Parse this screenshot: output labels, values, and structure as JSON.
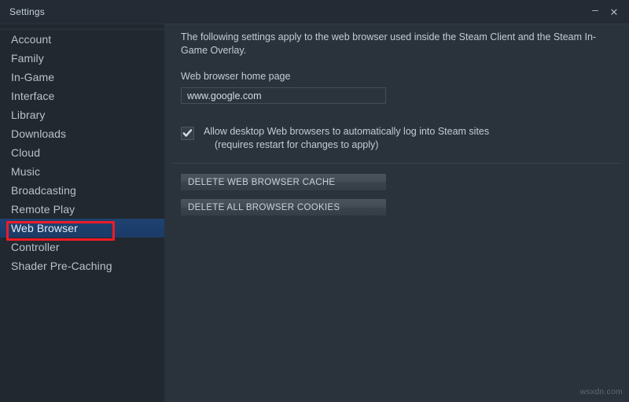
{
  "window": {
    "title": "Settings",
    "minimize_label": "–",
    "close_label": "✕"
  },
  "sidebar": {
    "items": [
      {
        "label": "Account",
        "selected": false
      },
      {
        "label": "Family",
        "selected": false
      },
      {
        "label": "In-Game",
        "selected": false
      },
      {
        "label": "Interface",
        "selected": false
      },
      {
        "label": "Library",
        "selected": false
      },
      {
        "label": "Downloads",
        "selected": false
      },
      {
        "label": "Cloud",
        "selected": false
      },
      {
        "label": "Music",
        "selected": false
      },
      {
        "label": "Broadcasting",
        "selected": false
      },
      {
        "label": "Remote Play",
        "selected": false
      },
      {
        "label": "Web Browser",
        "selected": true
      },
      {
        "label": "Controller",
        "selected": false
      },
      {
        "label": "Shader Pre-Caching",
        "selected": false
      }
    ],
    "selected_item": "Web Browser"
  },
  "annotation": {
    "target": "Web Browser",
    "color": "#ee1c25"
  },
  "content": {
    "intro": "The following settings apply to the web browser used inside the Steam Client and the Steam In-Game Overlay.",
    "home_page_label": "Web browser home page",
    "home_page_value": "www.google.com",
    "home_page_placeholder": "",
    "checkbox": {
      "checked": true,
      "line1": "Allow desktop Web browsers to automatically log into Steam sites",
      "line2": "(requires restart for changes to apply)"
    },
    "buttons": {
      "delete_cache": "DELETE WEB BROWSER CACHE",
      "delete_cookies": "DELETE ALL BROWSER COOKIES"
    }
  },
  "watermark": "wsxdn.com",
  "colors": {
    "window_bg": "#242c36",
    "sidebar_bg": "#22282f",
    "content_bg": "#2a323c",
    "selection_blue": "#1d4072",
    "annotation_red": "#ee1c25",
    "text_primary": "#c3ccd6"
  }
}
